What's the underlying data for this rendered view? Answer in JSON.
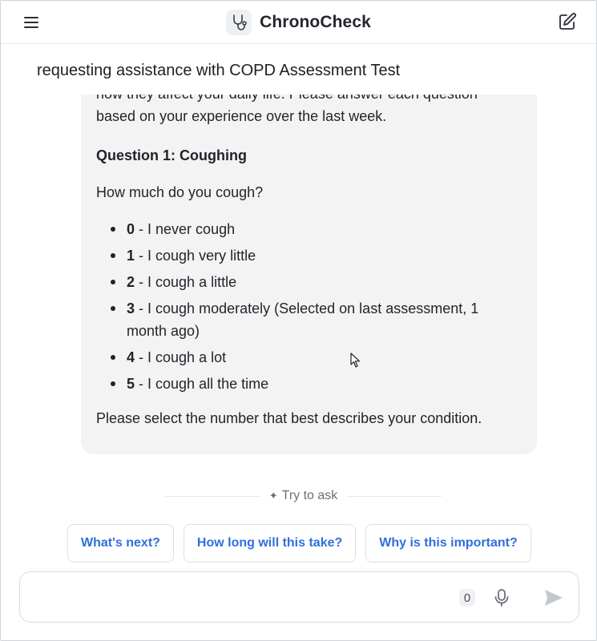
{
  "header": {
    "app_name": "ChronoCheck",
    "menu_icon": "hamburger-menu-icon",
    "logo_icon": "stethoscope-icon",
    "new_chat_icon": "edit-compose-icon"
  },
  "conversation": {
    "title": "requesting assistance with COPD Assessment Test"
  },
  "message": {
    "intro_partial": "how they affect your daily life. Please answer each question",
    "intro_line2": "based on your experience over the last week.",
    "question_heading": "Question 1: Coughing",
    "question_text": "How much do you cough?",
    "options": [
      {
        "number": "0",
        "text": "- I never cough"
      },
      {
        "number": "1",
        "text": "- I cough very little"
      },
      {
        "number": "2",
        "text": "- I cough a little"
      },
      {
        "number": "3",
        "text": "- I cough moderately (Selected on last assessment, 1 month ago)"
      },
      {
        "number": "4",
        "text": "- I cough a lot"
      },
      {
        "number": "5",
        "text": "- I cough all the time"
      }
    ],
    "closing": "Please select the number that best describes your condition."
  },
  "try_to_ask": {
    "label": "Try to ask",
    "icon": "sparkle-icon",
    "suggestions": [
      {
        "label": "What's next?"
      },
      {
        "label": "How long will this take?"
      },
      {
        "label": "Why is this important?"
      }
    ]
  },
  "composer": {
    "value": "",
    "placeholder": "",
    "char_count": "0",
    "mic_icon": "microphone-icon",
    "send_icon": "send-icon"
  },
  "colors": {
    "accent": "#2f6fde",
    "bubble_bg": "#f3f3f4",
    "text": "#1f2329"
  }
}
